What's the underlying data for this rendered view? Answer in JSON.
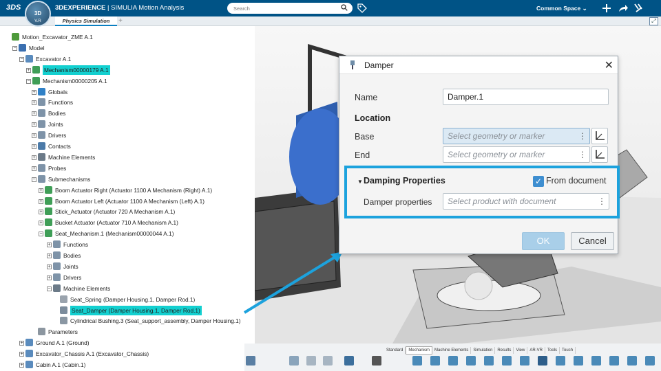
{
  "topbar": {
    "brand_logo": "3DS",
    "compass_label": "3D",
    "compass_version": "V.R",
    "app_title_bold": "3DEXPERIENCE",
    "app_title_rest": " | SIMULIA Motion Analysis",
    "search_placeholder": "Search",
    "space_label": "Common Space ⌄",
    "bg_color": "#005386"
  },
  "tabs": {
    "active": "Physics Simulation",
    "add": "+"
  },
  "tree": {
    "nodes": [
      {
        "label": "Motion_Excavator_ZME A.1",
        "expander": "",
        "icon": "assembly-icon",
        "highlighted": false
      },
      {
        "label": "Model",
        "expander": "−",
        "icon": "model-icon",
        "highlighted": false
      },
      {
        "label": "Excavator A.1",
        "expander": "−",
        "icon": "product-icon",
        "highlighted": false
      },
      {
        "label": "Mechanism00000179 A.1",
        "expander": "+",
        "icon": "mechanism-icon",
        "highlighted": true
      },
      {
        "label": "Mechanism00000205 A.1",
        "expander": "−",
        "icon": "mechanism-icon",
        "highlighted": false
      },
      {
        "label": "Globals",
        "expander": "+",
        "icon": "globe-icon",
        "highlighted": false
      },
      {
        "label": "Functions",
        "expander": "+",
        "icon": "folder-icon",
        "highlighted": false
      },
      {
        "label": "Bodies",
        "expander": "+",
        "icon": "folder-icon",
        "highlighted": false
      },
      {
        "label": "Joints",
        "expander": "+",
        "icon": "folder-icon",
        "highlighted": false
      },
      {
        "label": "Drivers",
        "expander": "+",
        "icon": "folder-icon",
        "highlighted": false
      },
      {
        "label": "Contacts",
        "expander": "+",
        "icon": "contacts-icon",
        "highlighted": false
      },
      {
        "label": "Machine Elements",
        "expander": "+",
        "icon": "gear-icon",
        "highlighted": false
      },
      {
        "label": "Probes",
        "expander": "+",
        "icon": "folder-icon",
        "highlighted": false
      },
      {
        "label": "Submechanisms",
        "expander": "−",
        "icon": "folder-icon",
        "highlighted": false
      },
      {
        "label": "Boom Actuator Right (Actuator 1100 A Mechanism (Right) A.1)",
        "expander": "+",
        "icon": "mechanism-icon",
        "highlighted": false
      },
      {
        "label": "Boom Actuator Left (Actuator 1100 A Mechanism (Left) A.1)",
        "expander": "+",
        "icon": "mechanism-icon",
        "highlighted": false
      },
      {
        "label": "Stick_Actuator (Actuator 720 A Mechanism A.1)",
        "expander": "+",
        "icon": "mechanism-icon",
        "highlighted": false
      },
      {
        "label": "Bucket Actuator (Actuator 710 A Mechanism A.1)",
        "expander": "+",
        "icon": "mechanism-icon",
        "highlighted": false
      },
      {
        "label": "Seat_Mechanism.1 (Mechanism00000044 A.1)",
        "expander": "−",
        "icon": "mechanism-icon",
        "highlighted": false
      },
      {
        "label": "Functions",
        "expander": "+",
        "icon": "folder-icon",
        "highlighted": false
      },
      {
        "label": "Bodies",
        "expander": "+",
        "icon": "folder-icon",
        "highlighted": false
      },
      {
        "label": "Joints",
        "expander": "+",
        "icon": "folder-icon",
        "highlighted": false
      },
      {
        "label": "Drivers",
        "expander": "+",
        "icon": "folder-icon",
        "highlighted": false
      },
      {
        "label": "Machine Elements",
        "expander": "−",
        "icon": "gear-icon",
        "highlighted": false
      },
      {
        "label": "Seat_Spring (Damper Housing.1, Damper Rod.1)",
        "expander": "",
        "icon": "spring-icon",
        "highlighted": false
      },
      {
        "label": "Seat_Damper (Damper Housing.1, Damper Rod.1)",
        "expander": "",
        "icon": "damper-icon",
        "highlighted": true
      },
      {
        "label": "Cylindrical Bushing.3 (Seat_support_assembly, Damper Housing.1)",
        "expander": "",
        "icon": "bushing-icon",
        "highlighted": false
      },
      {
        "label": "Parameters",
        "expander": "",
        "icon": "parameters-icon",
        "highlighted": false
      },
      {
        "label": "Ground A.1 (Ground)",
        "expander": "+",
        "icon": "product-icon",
        "highlighted": false
      },
      {
        "label": "Excavator_Chassis A.1 (Excavator_Chassis)",
        "expander": "+",
        "icon": "product-icon",
        "highlighted": false
      },
      {
        "label": "Cabin A.1 (Cabin.1)",
        "expander": "+",
        "icon": "product-icon",
        "highlighted": false
      }
    ]
  },
  "dialog": {
    "title": "Damper",
    "name_label": "Name",
    "name_value": "Damper.1",
    "location_heading": "Location",
    "base_label": "Base",
    "base_placeholder": "Select geometry or marker",
    "end_label": "End",
    "end_placeholder": "Select geometry or marker",
    "damping_heading": "Damping Properties",
    "from_document_label": "From document",
    "from_document_checked": true,
    "damper_properties_label": "Damper properties",
    "damper_properties_placeholder": "Select product with document",
    "ok_label": "OK",
    "cancel_label": "Cancel",
    "highlight_color": "#1ca2dd"
  },
  "action_bar": {
    "tabs": [
      "Standard",
      "Mechanism",
      "Machine Elements",
      "Simulation",
      "Results",
      "View",
      "AR-VR",
      "Tools",
      "Touch"
    ],
    "active_tab": "Mechanism"
  }
}
